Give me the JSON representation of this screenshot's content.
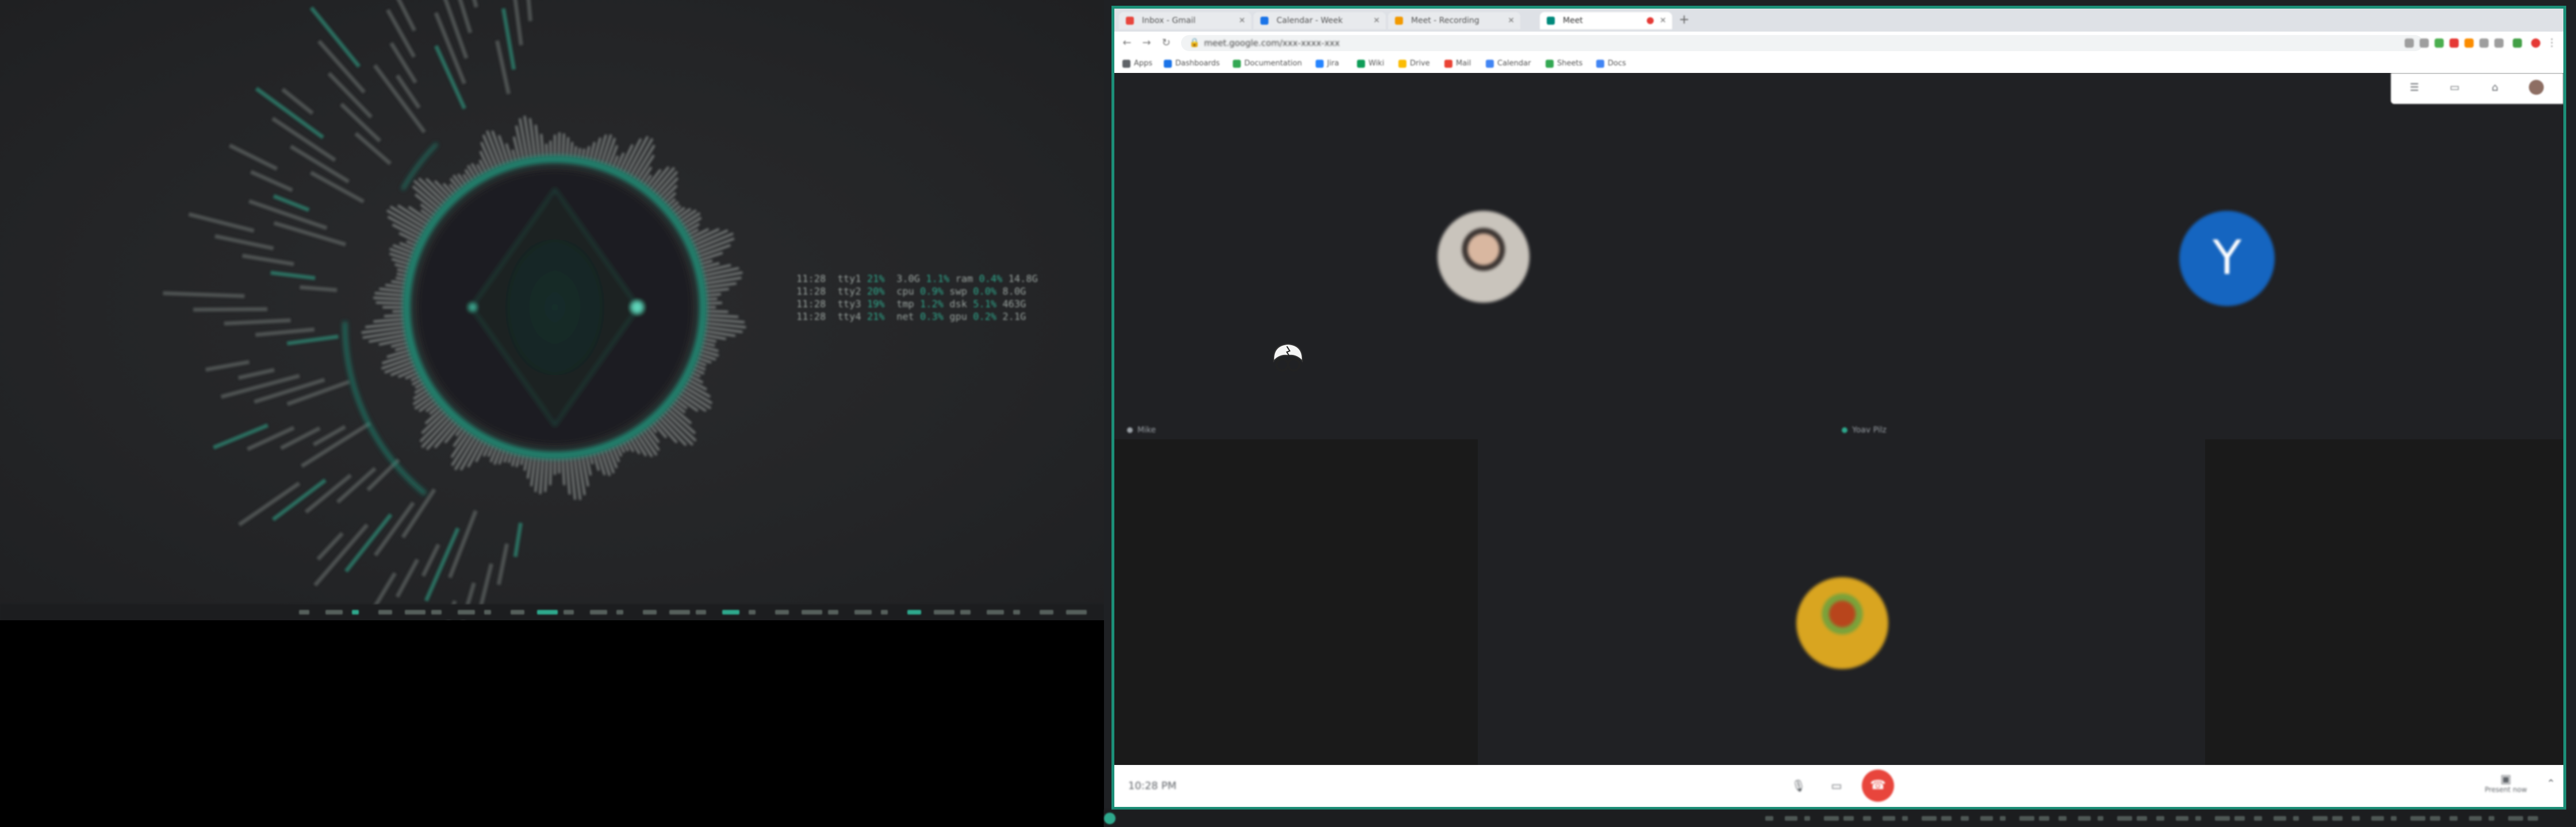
{
  "screen": {
    "accent": "#2ea88c",
    "browser_border": "#1c8f78"
  },
  "left_monitor": {
    "visualizer": {
      "name": "circular-audio-visualizer",
      "ring_color": "#1f8f78"
    },
    "sys_table": {
      "rows": [
        [
          "11:28",
          "tty1",
          "21%",
          "3.0G",
          "1.1%",
          "ram",
          "0.4%",
          "14.8G"
        ],
        [
          "11:28",
          "tty2",
          "20%",
          "cpu",
          "0.9%",
          "swp",
          "0.0%",
          "8.0G"
        ],
        [
          "11:28",
          "tty3",
          "19%",
          "tmp",
          "1.2%",
          "dsk",
          "5.1%",
          "463G"
        ],
        [
          "11:28",
          "tty4",
          "21%",
          "net",
          "0.3%",
          "gpu",
          "0.2%",
          "2.1G"
        ]
      ]
    }
  },
  "browser": {
    "tabs": [
      {
        "label": "Inbox - Gmail",
        "favicon_color": "#e8453c",
        "active": false
      },
      {
        "label": "Calendar - Week",
        "favicon_color": "#1a73e8",
        "active": false
      },
      {
        "label": "Meet - Recording",
        "favicon_color": "#f29900",
        "active": false
      },
      {
        "label": "Meet",
        "favicon_color": "#00897b",
        "active": true,
        "recording": true
      }
    ],
    "new_tab_label": "+",
    "address": {
      "url": "meet.google.com/xxx-xxxx-xxx",
      "lock_icon": "lock-icon"
    },
    "bookmarks": [
      {
        "label": "Apps",
        "color": "#5f6368"
      },
      {
        "label": "Dashboards",
        "color": "#1a73e8"
      },
      {
        "label": "Documentation",
        "color": "#34a853"
      },
      {
        "label": "Jira",
        "color": "#2684ff"
      },
      {
        "label": "Wiki",
        "color": "#0f9d58"
      },
      {
        "label": "Drive",
        "color": "#fbbc04"
      },
      {
        "label": "Mail",
        "color": "#ea4335"
      },
      {
        "label": "Calendar",
        "color": "#4285f4"
      },
      {
        "label": "Sheets",
        "color": "#34a853"
      },
      {
        "label": "Docs",
        "color": "#4285f4"
      }
    ]
  },
  "meeting": {
    "participants": [
      {
        "name": "Mike",
        "avatar": "photo",
        "avatar_color": "#c9c4bc"
      },
      {
        "name": "Yoav Pilz",
        "avatar": "initial",
        "initial": "Y",
        "avatar_color": "#1565c0"
      },
      {
        "name": "",
        "avatar": "illustration",
        "avatar_color": "#d9a520"
      }
    ],
    "bottom_bar": {
      "meeting_time": "10:28 PM",
      "present_label": "Present now",
      "end_call_icon": "phone-hangup-icon"
    }
  }
}
